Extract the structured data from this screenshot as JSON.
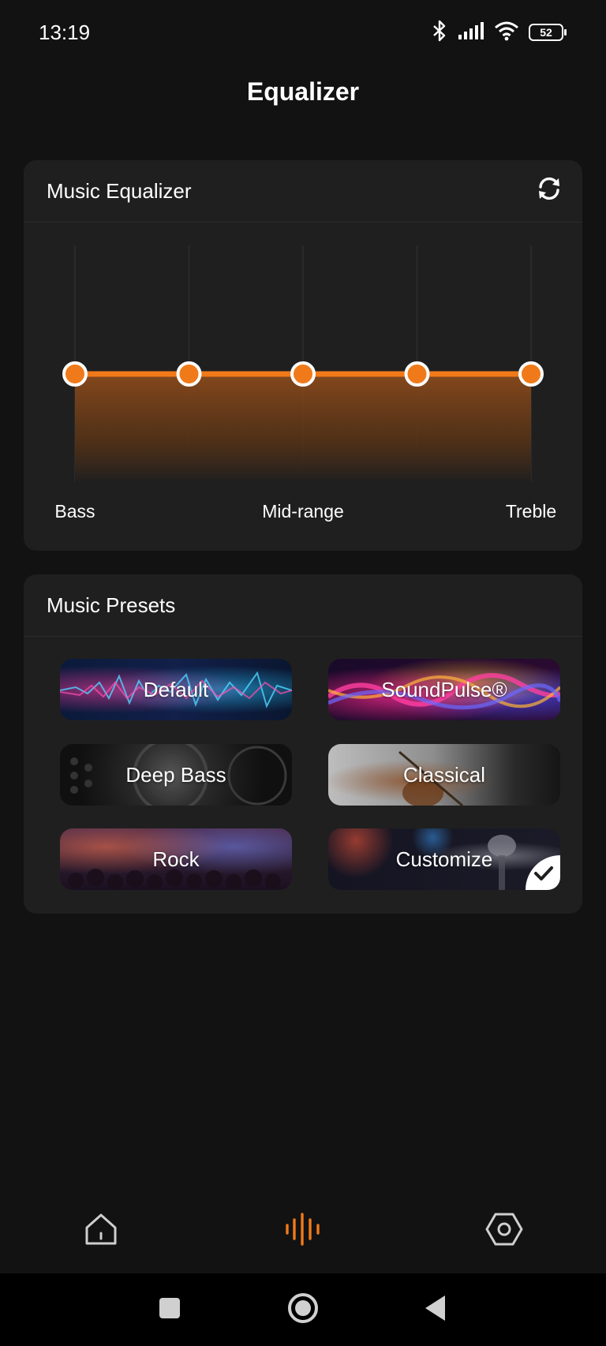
{
  "status_bar": {
    "time": "13:19",
    "battery_level": "52",
    "icons": [
      "bluetooth-icon",
      "signal-icon",
      "wifi-icon",
      "battery-icon"
    ]
  },
  "page": {
    "title": "Equalizer"
  },
  "equalizer": {
    "title": "Music Equalizer",
    "reset_icon": "refresh-icon",
    "accent_color": "#f07a1a",
    "band_levels": [
      0,
      0,
      0,
      0,
      0
    ],
    "labels": {
      "bass": "Bass",
      "mid": "Mid-range",
      "treble": "Treble"
    }
  },
  "presets": {
    "title": "Music Presets",
    "items": [
      {
        "label": "Default"
      },
      {
        "label": "SoundPulse®"
      },
      {
        "label": "Deep Bass"
      },
      {
        "label": "Classical"
      },
      {
        "label": "Rock"
      },
      {
        "label": "Customize",
        "selected": true
      }
    ]
  },
  "bottom_nav": {
    "items": [
      {
        "icon": "home-icon"
      },
      {
        "icon": "equalizer-icon",
        "active": true
      },
      {
        "icon": "settings-icon"
      }
    ],
    "active_color": "#f07a1a"
  },
  "system_nav": {
    "buttons": [
      "recents-button",
      "home-button",
      "back-button"
    ]
  }
}
